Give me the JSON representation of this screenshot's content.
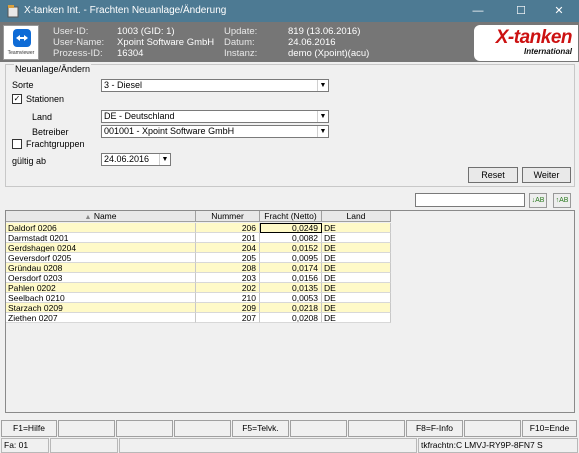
{
  "window": {
    "title": "X-tanken Int. - Frachten Neuanlage/Änderung",
    "controls": {
      "minimize": "—",
      "maximize": "☐",
      "close": "✕"
    }
  },
  "header": {
    "teamviewer_label": "Teamviewer",
    "left_labels": [
      "User-ID:",
      "User-Name:",
      "Prozess-ID:"
    ],
    "left_values": [
      "1003 (GID: 1)",
      "Xpoint Software GmbH",
      "16304"
    ],
    "right_labels": [
      "Update:",
      "Datum:",
      "Instanz:"
    ],
    "right_values": [
      "819 (13.06.2016)",
      "24.06.2016",
      "demo (Xpoint)(acu)"
    ],
    "logo_main": "X-tanken",
    "logo_sub": "International"
  },
  "form": {
    "legend": "Neuanlage/Ändern",
    "sorte_label": "Sorte",
    "sorte_value": "3 - Diesel",
    "stationen_label": "Stationen",
    "stationen_checked": true,
    "land_label": "Land",
    "land_value": "DE - Deutschland",
    "betreiber_label": "Betreiber",
    "betreiber_value": "001001 - Xpoint Software GmbH",
    "frachtgruppen_label": "Frachtgruppen",
    "frachtgruppen_checked": false,
    "gueltig_label": "gültig ab",
    "gueltig_value": "24.06.2016",
    "reset_label": "Reset",
    "weiter_label": "Weiter"
  },
  "grid": {
    "columns": [
      "Name",
      "Nummer",
      "Fracht (Netto)",
      "Land"
    ],
    "sort_indicator": "▲",
    "rows": [
      {
        "name": "Daldorf 0206",
        "nummer": "206",
        "fracht": "0,0249",
        "land": "DE",
        "highlight": true
      },
      {
        "name": "Darmstadt 0201",
        "nummer": "201",
        "fracht": "0,0082",
        "land": "DE",
        "highlight": false
      },
      {
        "name": "Gerdshagen 0204",
        "nummer": "204",
        "fracht": "0,0152",
        "land": "DE",
        "highlight": true
      },
      {
        "name": "Geversdorf 0205",
        "nummer": "205",
        "fracht": "0,0095",
        "land": "DE",
        "highlight": false
      },
      {
        "name": "Gründau 0208",
        "nummer": "208",
        "fracht": "0,0174",
        "land": "DE",
        "highlight": true
      },
      {
        "name": "Oersdorf 0203",
        "nummer": "203",
        "fracht": "0,0156",
        "land": "DE",
        "highlight": false
      },
      {
        "name": "Pahlen 0202",
        "nummer": "202",
        "fracht": "0,0135",
        "land": "DE",
        "highlight": true
      },
      {
        "name": "Seelbach 0210",
        "nummer": "210",
        "fracht": "0,0053",
        "land": "DE",
        "highlight": false
      },
      {
        "name": "Starzach 0209",
        "nummer": "209",
        "fracht": "0,0218",
        "land": "DE",
        "highlight": true
      },
      {
        "name": "Ziethen 0207",
        "nummer": "207",
        "fracht": "0,0208",
        "land": "DE",
        "highlight": false
      }
    ]
  },
  "fkeys": [
    "F1=Hilfe",
    "",
    "",
    "",
    "F5=Telvk.",
    "",
    "",
    "F8=F-Info",
    "",
    "F10=Ende"
  ],
  "status": {
    "left": "Fa: 01",
    "right": "tkfrachtn:C LMVJ-RY9P-8FN7 S"
  },
  "colors": {
    "titlebar": "#4d7a93",
    "infobar": "#767676",
    "row_highlight": "#fffac8",
    "row_normal": "#ffffff",
    "logo_red": "#cc1111"
  }
}
